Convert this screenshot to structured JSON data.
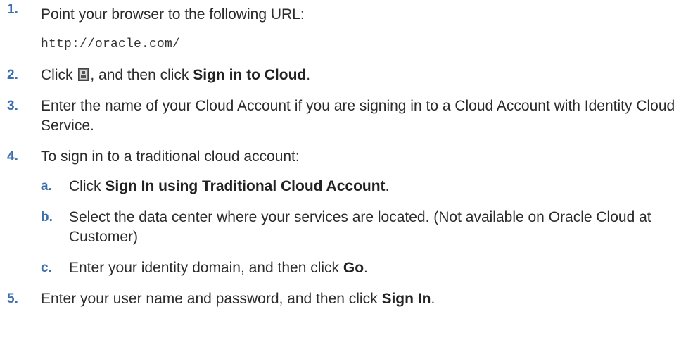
{
  "steps": [
    {
      "number": "1.",
      "text": "Point your browser to the following URL:",
      "code": "http://oracle.com/"
    },
    {
      "number": "2.",
      "text_before_icon": "Click ",
      "icon": "profile-icon",
      "text_after_icon": ", and then click ",
      "bold": "Sign in to Cloud",
      "text_end": "."
    },
    {
      "number": "3.",
      "text": "Enter the name of your Cloud Account if you are signing in to a Cloud Account with Identity Cloud Service."
    },
    {
      "number": "4.",
      "text": "To sign in to a traditional cloud account:",
      "substeps": [
        {
          "letter": "a.",
          "text_before": "Click ",
          "bold": "Sign In using Traditional Cloud Account",
          "text_end": "."
        },
        {
          "letter": "b.",
          "text": "Select the data center where your services are located. (Not available on Oracle Cloud at Customer)"
        },
        {
          "letter": "c.",
          "text_before": "Enter your identity domain, and then click ",
          "bold": "Go",
          "text_end": "."
        }
      ]
    },
    {
      "number": "5.",
      "text_before": "Enter your user name and password, and then click ",
      "bold": "Sign In",
      "text_end": "."
    }
  ],
  "colors": {
    "number": "#3d6fae",
    "text": "#2b2b2b"
  }
}
